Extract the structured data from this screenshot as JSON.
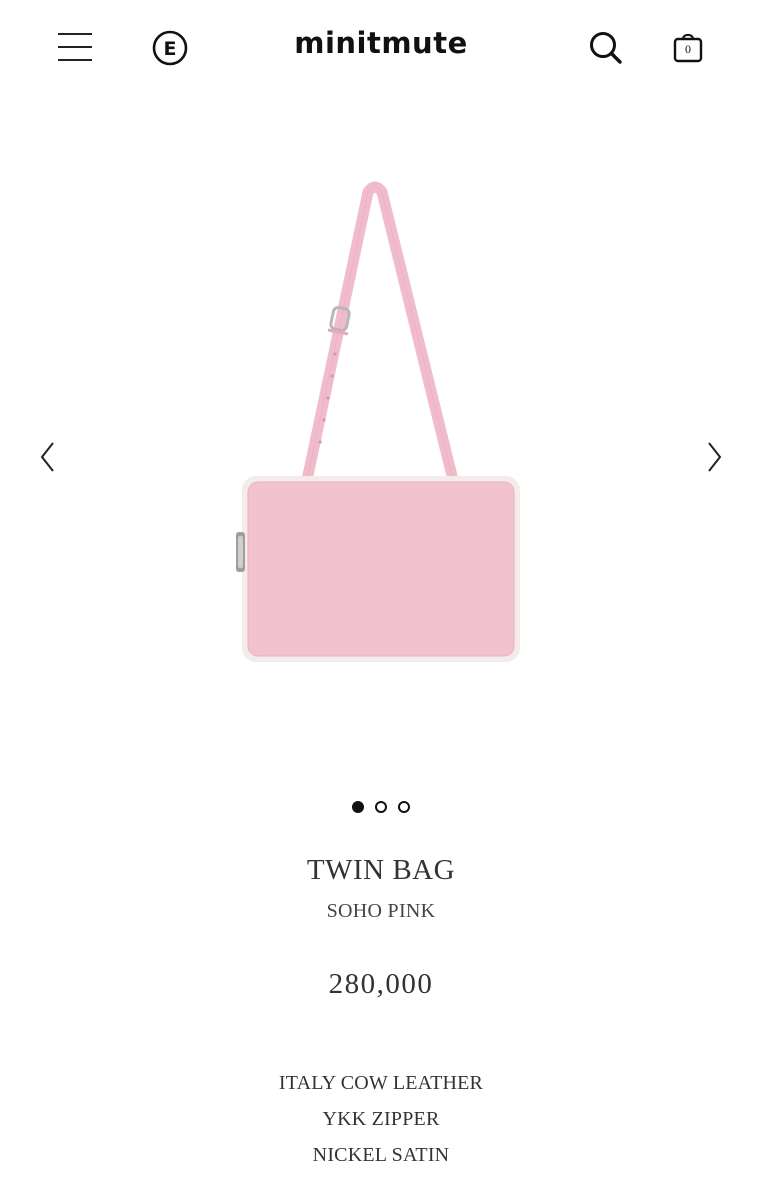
{
  "header": {
    "logo": "minitmute",
    "language_letter": "E",
    "cart_count": "0",
    "icons": {
      "menu": "hamburger-menu-icon",
      "language": "language-e-icon",
      "search": "search-icon",
      "cart": "shopping-bag-icon"
    }
  },
  "gallery": {
    "image": "pink leather shoulder bag with adjustable strap and silver zipper pull",
    "bag_color": "#f2c2cf",
    "trim_color": "#f3ecea",
    "strap_color": "#f0bccb",
    "slide_count": 3,
    "active_slide": 1,
    "prev_icon": "chevron-left-icon",
    "next_icon": "chevron-right-icon"
  },
  "product": {
    "name": "TWIN BAG",
    "color": "SOHO PINK",
    "price": "280,000",
    "specs": [
      "ITALY COW LEATHER",
      "YKK ZIPPER",
      "NICKEL SATIN"
    ]
  }
}
